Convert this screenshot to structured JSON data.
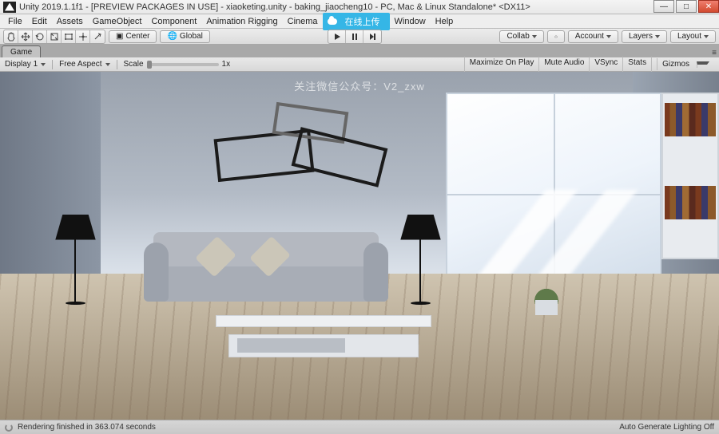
{
  "window": {
    "title": "Unity 2019.1.1f1 - [PREVIEW PACKAGES IN USE] - xiaoketing.unity - baking_jiaocheng10 - PC, Mac & Linux Standalone* <DX11>"
  },
  "menu": {
    "items": [
      "File",
      "Edit",
      "Assets",
      "GameObject",
      "Component",
      "Animation Rigging",
      "Cinema"
    ],
    "highlight": "在线上传",
    "items2": [
      "Window",
      "Help"
    ]
  },
  "toolbar": {
    "center": "Center",
    "global": "Global",
    "collab": "Collab",
    "account": "Account",
    "layers": "Layers",
    "layout": "Layout"
  },
  "tabs": {
    "game": "Game"
  },
  "control": {
    "display_label": "Display 1",
    "aspect": "Free Aspect",
    "scale_label": "Scale",
    "scale_value": "1x",
    "maximize": "Maximize On Play",
    "mute": "Mute Audio",
    "vsync": "VSync",
    "stats": "Stats",
    "gizmos": "Gizmos"
  },
  "viewport": {
    "watermark": "关注微信公众号：V2_zxw"
  },
  "status": {
    "left": "Rendering finished in 363.074 seconds",
    "right": "Auto Generate Lighting Off"
  }
}
